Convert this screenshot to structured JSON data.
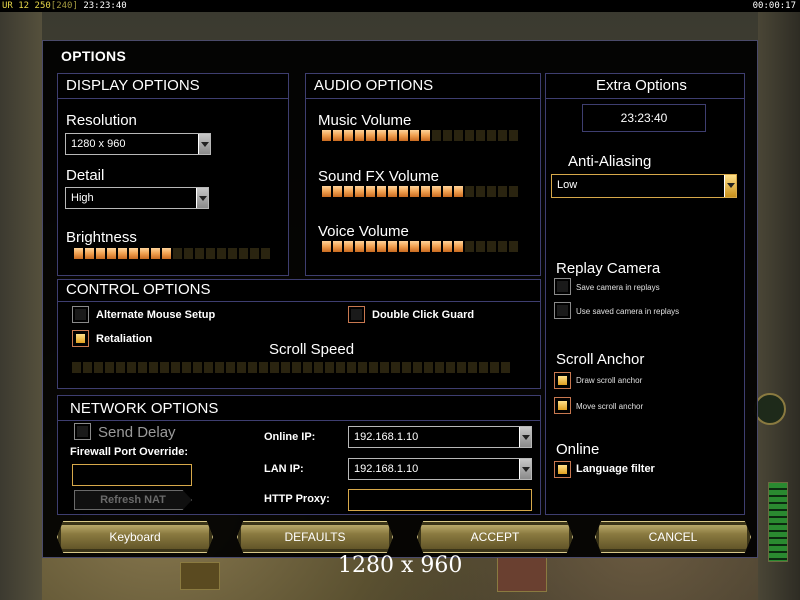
{
  "topbar": {
    "left_prefix": "UR",
    "left_num1": "12",
    "left_num2": "250",
    "left_bracket": "[240]",
    "left_time": "23:23:40",
    "right_time": "00:00:17"
  },
  "window": {
    "title": "OPTIONS"
  },
  "display": {
    "heading": "DISPLAY OPTIONS",
    "resolution_label": "Resolution",
    "resolution_value": "1280 x 960",
    "detail_label": "Detail",
    "detail_value": "High",
    "brightness_label": "Brightness",
    "brightness_level": 0.5
  },
  "audio": {
    "heading": "AUDIO OPTIONS",
    "music_label": "Music Volume",
    "music_level": 0.56,
    "sfx_label": "Sound FX Volume",
    "sfx_level": 0.7,
    "voice_label": "Voice Volume",
    "voice_level": 0.7
  },
  "extra": {
    "heading": "Extra Options",
    "clock": "23:23:40",
    "aa_label": "Anti-Aliasing",
    "aa_value": "Low",
    "replay_heading": "Replay Camera",
    "replay_opt1": "Save camera in replays",
    "replay_opt2": "Use saved camera in replays",
    "scroll_heading": "Scroll Anchor",
    "scroll_opt1": "Draw scroll anchor",
    "scroll_opt2": "Move scroll anchor",
    "online_heading": "Online",
    "online_opt1": "Language filter"
  },
  "control": {
    "heading": "CONTROL OPTIONS",
    "alt_mouse": "Alternate Mouse Setup",
    "double_click": "Double Click Guard",
    "retaliation": "Retaliation",
    "scroll_speed_label": "Scroll Speed",
    "scroll_speed_level": 0
  },
  "network": {
    "heading": "NETWORK OPTIONS",
    "send_delay": "Send Delay",
    "firewall_label": "Firewall Port Override:",
    "firewall_value": "",
    "refresh_label": "Refresh NAT",
    "online_ip_label": "Online IP:",
    "online_ip_value": "192.168.1.10",
    "lan_ip_label": "LAN IP:",
    "lan_ip_value": "192.168.1.10",
    "http_proxy_label": "HTTP Proxy:",
    "http_proxy_value": ""
  },
  "buttons": {
    "keyboard": "Keyboard",
    "defaults": "DEFAULTS",
    "accept": "ACCEPT",
    "cancel": "CANCEL"
  },
  "caption": "1280 x 960",
  "colors": {
    "accent_gold": "#d6a84a",
    "slider_on": "#f0a050",
    "panel_border": "#3e3e70"
  }
}
